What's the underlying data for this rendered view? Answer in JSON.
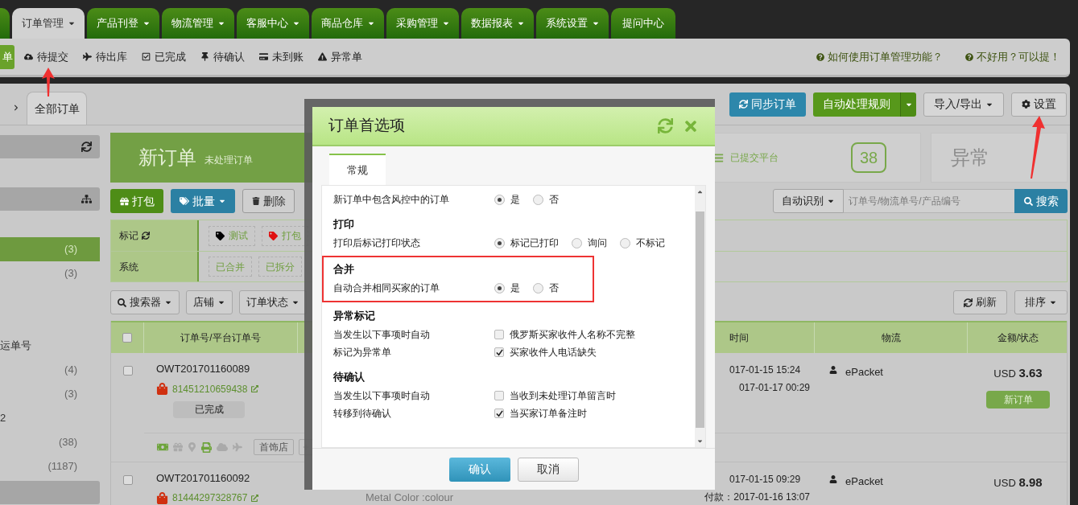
{
  "nav_tabs": [
    {
      "label": "订单管理",
      "dropdown": true,
      "selected": true
    },
    {
      "label": "产品刊登",
      "dropdown": true,
      "selected": false
    },
    {
      "label": "物流管理",
      "dropdown": true,
      "selected": false
    },
    {
      "label": "客服中心",
      "dropdown": true,
      "selected": false
    },
    {
      "label": "商品仓库",
      "dropdown": true,
      "selected": false
    },
    {
      "label": "采购管理",
      "dropdown": true,
      "selected": false
    },
    {
      "label": "数据报表",
      "dropdown": true,
      "selected": false
    },
    {
      "label": "系统设置",
      "dropdown": true,
      "selected": false
    },
    {
      "label": "提问中心",
      "dropdown": false,
      "selected": false
    }
  ],
  "sub_nav": {
    "current": "单",
    "items": [
      {
        "kind": "submit",
        "label": "待提交"
      },
      {
        "kind": "ship",
        "label": "待出库"
      },
      {
        "kind": "done",
        "label": "已完成"
      },
      {
        "kind": "confirm",
        "label": "待确认"
      },
      {
        "kind": "unpaid",
        "label": "未到账"
      },
      {
        "kind": "abnormal",
        "label": "异常单"
      }
    ]
  },
  "help_links": [
    "如何使用订单管理功能？",
    "不好用？可以提！"
  ],
  "breadcrumb": {
    "tab": "全部订单"
  },
  "header_buttons": [
    {
      "kind": "sync",
      "label": "同步订单"
    },
    {
      "kind": "rules",
      "label": "自动处理规则"
    },
    {
      "kind": "import",
      "label": "导入/导出"
    },
    {
      "kind": "settings",
      "label": "设置"
    }
  ],
  "sidebar": [
    {
      "kind": "sync_header"
    },
    {
      "kind": "item",
      "selected": false
    },
    {
      "kind": "tree_header"
    },
    {
      "kind": "item",
      "selected": false
    },
    {
      "kind": "item",
      "selected": true,
      "count": "(3)"
    },
    {
      "kind": "item",
      "selected": false,
      "count": "(3)"
    },
    {
      "kind": "item",
      "selected": false
    },
    {
      "kind": "item",
      "selected": false
    },
    {
      "kind": "item",
      "selected": false,
      "label": "运单号"
    },
    {
      "kind": "item",
      "selected": false,
      "count": "(4)"
    },
    {
      "kind": "item",
      "selected": false,
      "count": "(3)"
    },
    {
      "kind": "item",
      "selected": false,
      "label": "2"
    },
    {
      "kind": "item",
      "selected": false,
      "count": "(38)"
    },
    {
      "kind": "item",
      "selected": false,
      "count": "(1187)"
    },
    {
      "kind": "header"
    }
  ],
  "summary": {
    "new_title": "新订单",
    "new_subtitle": "未处理订单",
    "submitted_label": "已提交平台",
    "submitted_count": "38",
    "abnormal_title": "异常"
  },
  "toolbar": [
    {
      "kind": "pack",
      "label": "打包"
    },
    {
      "kind": "batch",
      "label": "批量"
    },
    {
      "kind": "delete",
      "label": "删除"
    }
  ],
  "search": {
    "mode": "自动识别",
    "placeholder": "订单号/物流单号/产品编号",
    "button": "搜索"
  },
  "filters": [
    {
      "kind": "tags",
      "label": "标记",
      "tags": [
        {
          "label": "测试",
          "color": "#000000"
        },
        {
          "label": "打包",
          "color": "#e01010"
        }
      ]
    },
    {
      "kind": "system",
      "label": "系统",
      "tags": [
        {
          "label": "已合并"
        },
        {
          "label": "已拆分"
        }
      ]
    }
  ],
  "filter_dropdowns": [
    "搜索器",
    "店铺",
    "订单状态"
  ],
  "list_actions": [
    {
      "kind": "refresh",
      "label": "刷新"
    },
    {
      "kind": "sort",
      "label": "排序"
    }
  ],
  "table": {
    "header_checked": false,
    "columns": [
      "订单号/平台订单号",
      "时间",
      "物流",
      "金额/状态"
    ],
    "rows": [
      {
        "checked": false,
        "order_no": "OWT201701160089",
        "platform_no": "81451210659438",
        "status_badge": "已完成",
        "shop_tag": "首饰店",
        "times": [
          "017-01-15 15:24",
          "017-01-17 00:29"
        ],
        "logistics": "ePacket",
        "currency": "USD",
        "amount": "3.63",
        "state": "新订单"
      },
      {
        "checked": false,
        "order_no": "OWT201701160092",
        "platform_no": "81444297328767",
        "product_attr": "Metal Color :colour",
        "times": [
          "017-01-15 09:29",
          "2017-01-16 13:07"
        ],
        "paid_label": "付款：",
        "logistics": "ePacket",
        "currency": "USD",
        "amount": "8.98"
      }
    ]
  },
  "dialog": {
    "title": "订单首选项",
    "tabs": [
      {
        "label": "常规",
        "selected": true
      }
    ],
    "sections": [
      {
        "highlighted": false,
        "rows": [
          {
            "kind": "radio",
            "label": [
              "新订单中包含风控中的订单"
            ],
            "options": [
              {
                "label": "是",
                "selected": true
              },
              {
                "label": "否",
                "selected": false
              }
            ]
          }
        ]
      },
      {
        "heading": "打印",
        "highlighted": false,
        "rows": [
          {
            "kind": "radio",
            "label": [
              "打印后标记打印状态"
            ],
            "options": [
              {
                "label": "标记已打印",
                "selected": true
              },
              {
                "label": "询问",
                "selected": false
              },
              {
                "label": "不标记",
                "selected": false
              }
            ]
          }
        ]
      },
      {
        "heading": "合并",
        "highlighted": true,
        "rows": [
          {
            "kind": "radio",
            "label": [
              "自动合并相同买家的订单"
            ],
            "options": [
              {
                "label": "是",
                "selected": true
              },
              {
                "label": "否",
                "selected": false
              }
            ]
          }
        ]
      },
      {
        "heading": "异常标记",
        "highlighted": false,
        "rows": [
          {
            "kind": "checks",
            "label": [
              "当发生以下事项时自动",
              "标记为异常单"
            ],
            "options": [
              {
                "label": "俄罗斯买家收件人名称不完整",
                "checked": false
              },
              {
                "label": "买家收件人电话缺失",
                "checked": true
              }
            ]
          }
        ]
      },
      {
        "heading": "待确认",
        "highlighted": false,
        "rows": [
          {
            "kind": "checks",
            "label": [
              "当发生以下事项时自动",
              "转移到待确认"
            ],
            "options": [
              {
                "label": "当收到未处理订单留言时",
                "checked": false
              },
              {
                "label": "当买家订单备注时",
                "checked": true
              }
            ]
          }
        ]
      }
    ],
    "buttons": [
      {
        "kind": "primary",
        "label": "确认"
      },
      {
        "kind": "default",
        "label": "取消"
      }
    ]
  }
}
